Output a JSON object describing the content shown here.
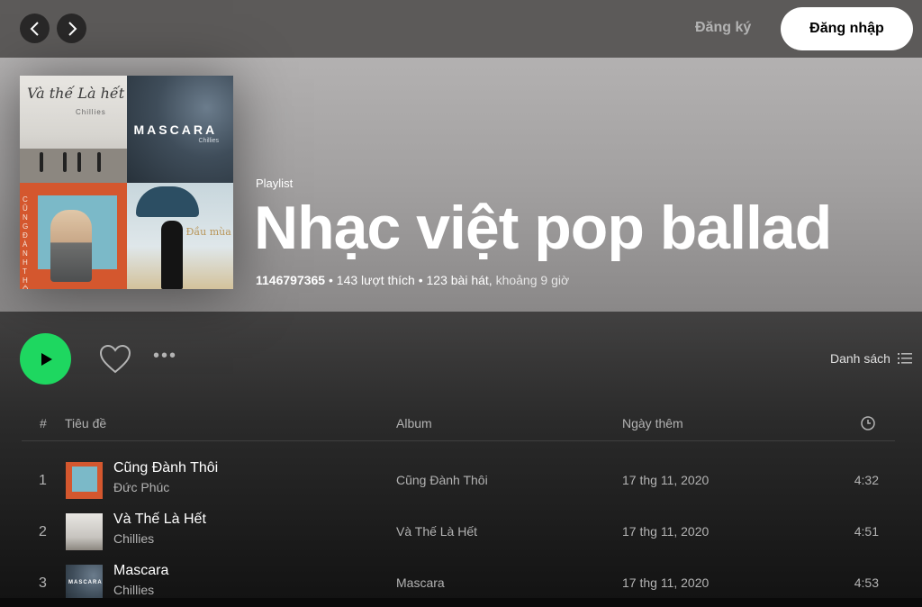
{
  "topbar": {
    "signup_label": "Đăng ký",
    "login_label": "Đăng nhập"
  },
  "playlist": {
    "type": "Playlist",
    "title": "Nhạc việt pop ballad",
    "owner": "1146797365",
    "likes": "143 lượt thích",
    "songs": "123 bài hát,",
    "duration": "khoảng 9 giờ"
  },
  "cover_art": {
    "tile1_title": "Và thế Là hết",
    "tile1_artist": "Chillies",
    "tile2_title": "MASCARA",
    "tile2_artist": "Chillies",
    "tile3_title": "CŨNG ĐÀNH THÔI",
    "tile4_title": "Đầu mùa"
  },
  "actions": {
    "view_mode_label": "Danh sách"
  },
  "table": {
    "headers": {
      "num": "#",
      "title": "Tiêu đề",
      "album": "Album",
      "date_added": "Ngày thêm"
    },
    "rows": [
      {
        "num": "1",
        "name": "Cũng Đành Thôi",
        "artist": "Đức Phúc",
        "album": "Cũng Đành Thôi",
        "date": "17 thg 11, 2020",
        "duration": "4:32"
      },
      {
        "num": "2",
        "name": "Và Thế Là Hết",
        "artist": "Chillies",
        "album": "Và Thế Là Hết",
        "date": "17 thg 11, 2020",
        "duration": "4:51"
      },
      {
        "num": "3",
        "name": "Mascara",
        "artist": "Chillies",
        "album": "Mascara",
        "date": "17 thg 11, 2020",
        "duration": "4:53",
        "thumb_text": "MASCARA"
      }
    ]
  },
  "colors": {
    "accent": "#1ed760",
    "header_bg": "#a9a7a7",
    "background": "#121212"
  }
}
